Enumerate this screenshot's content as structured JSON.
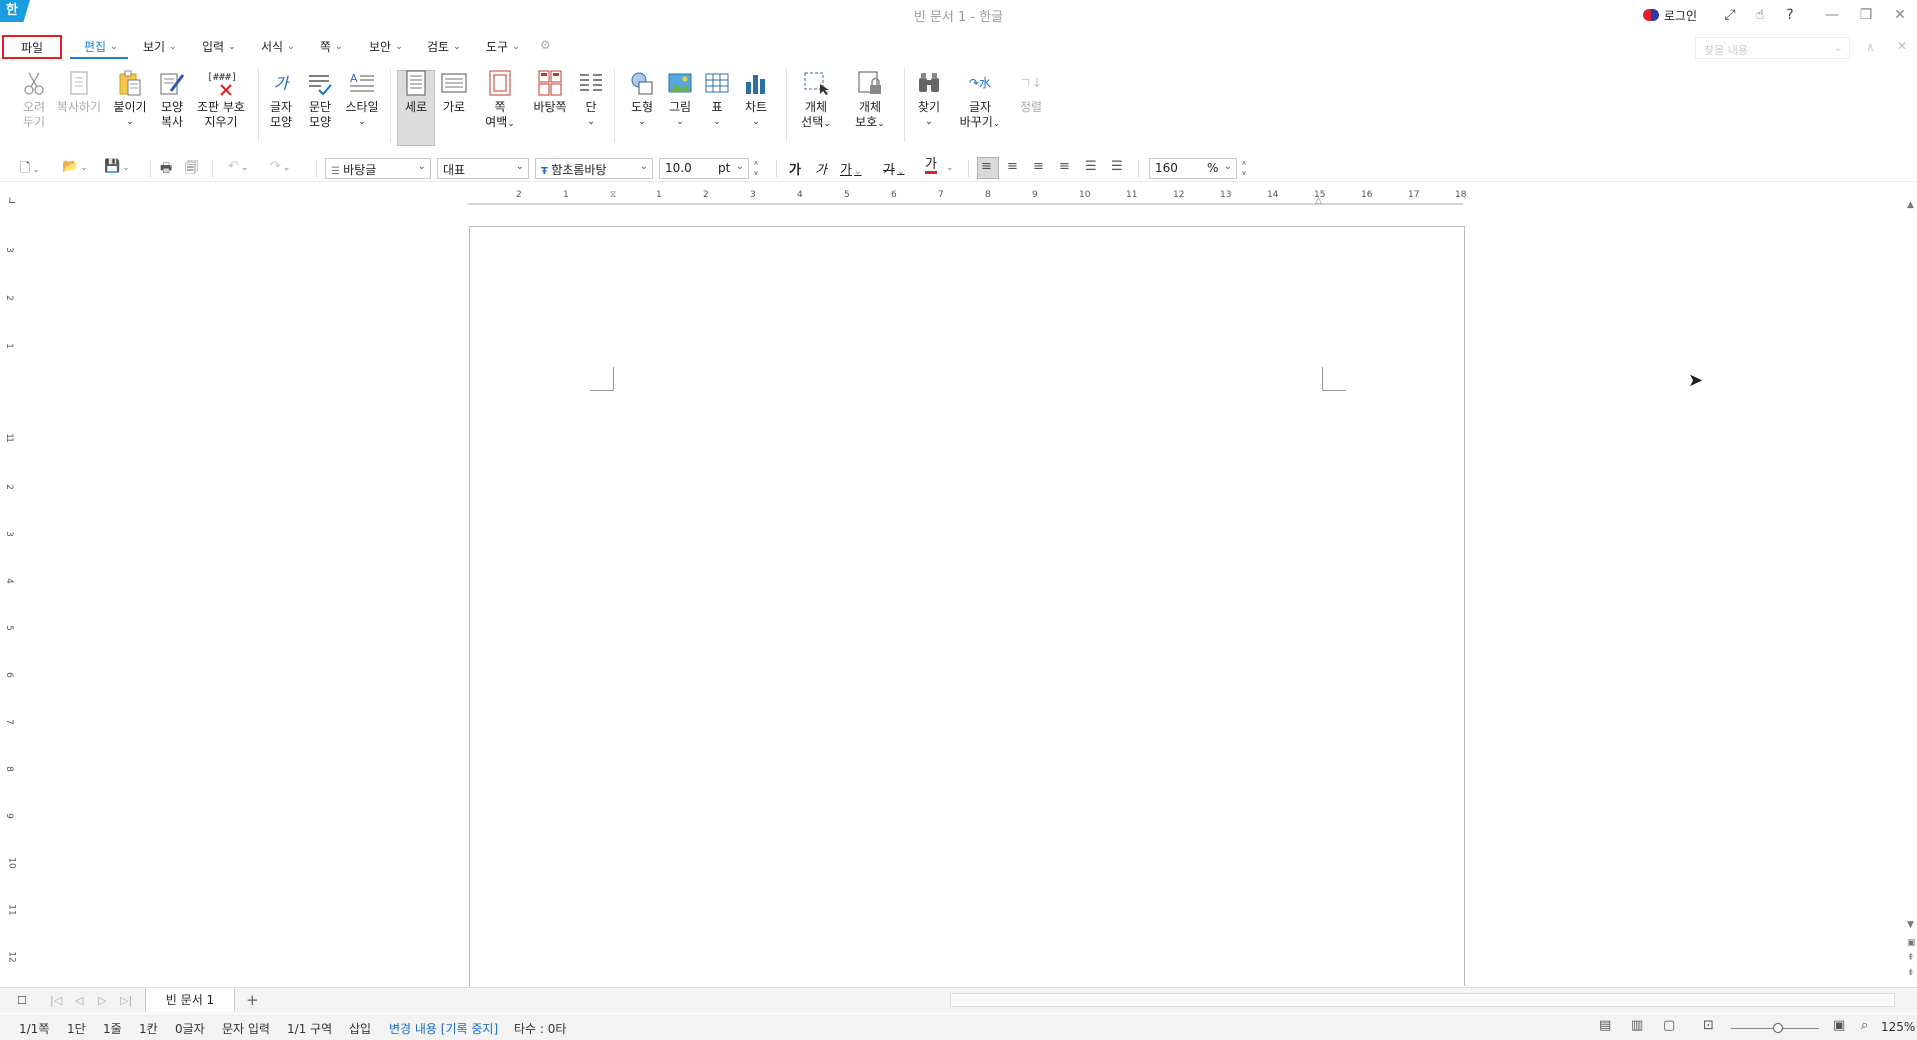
{
  "window": {
    "app_logo": "한",
    "title": "빈 문서 1 - 한글",
    "login_label": "로그인"
  },
  "menu": {
    "file": "파일",
    "items": [
      "편집",
      "보기",
      "입력",
      "서식",
      "쪽",
      "보안",
      "검토",
      "도구"
    ],
    "active": "편집",
    "find_placeholder": "찾을 내용"
  },
  "ribbon": {
    "cut": [
      "오려",
      "두기"
    ],
    "copy": "복사하기",
    "paste": "붙이기",
    "format_copy": [
      "모양",
      "복사"
    ],
    "clear_codes": [
      "조판 부호",
      "지우기"
    ],
    "char_shape": [
      "글자",
      "모양"
    ],
    "para_shape": [
      "문단",
      "모양"
    ],
    "style": "스타일",
    "portrait": "세로",
    "landscape": "가로",
    "margins": [
      "쪽",
      "여백"
    ],
    "master_page": "바탕쪽",
    "columns": "단",
    "shape": "도형",
    "picture": "그림",
    "table": "표",
    "chart": "차트",
    "object_select": [
      "개체",
      "선택"
    ],
    "object_protect": [
      "개체",
      "보호"
    ],
    "find": "찾기",
    "replace": [
      "글자",
      "바꾸기"
    ],
    "sort": "정렬",
    "clear_codes_icon_text": "[###]"
  },
  "toolbar": {
    "style_combo": "바탕글",
    "lang_combo": "대표",
    "font_combo": "함초롬바탕",
    "font_size": "10.0",
    "font_unit": "pt",
    "zoom_value": "160",
    "zoom_unit": "%",
    "char_buttons": [
      "가",
      "가",
      "가",
      "가",
      "가"
    ]
  },
  "ruler": {
    "h_ticks": [
      "2",
      "1",
      "1",
      "2",
      "3",
      "4",
      "5",
      "6",
      "7",
      "8",
      "9",
      "10",
      "11",
      "12",
      "13",
      "14",
      "15",
      "16",
      "17",
      "18"
    ],
    "v_ticks": [
      "3",
      "2",
      "1",
      "1",
      "1",
      "2",
      "3",
      "4",
      "5",
      "6",
      "7",
      "8",
      "9",
      "10",
      "11",
      "12"
    ]
  },
  "tabs": {
    "doc_tab": "빈 문서 1",
    "add": "+"
  },
  "status": {
    "page": "1/1쪽",
    "column": "1단",
    "line": "1줄",
    "cell": "1칸",
    "chars": "0글자",
    "mode": "문자 입력",
    "section": "1/1 구역",
    "insert": "삽입",
    "track_changes": "변경 내용 [기록 중지]",
    "keystrokes": "타수 : 0타",
    "zoom": "125%"
  },
  "colors": {
    "accent": "#1b7fd4",
    "file_highlight": "#e02020",
    "logo_bg": "#1a9de0"
  }
}
